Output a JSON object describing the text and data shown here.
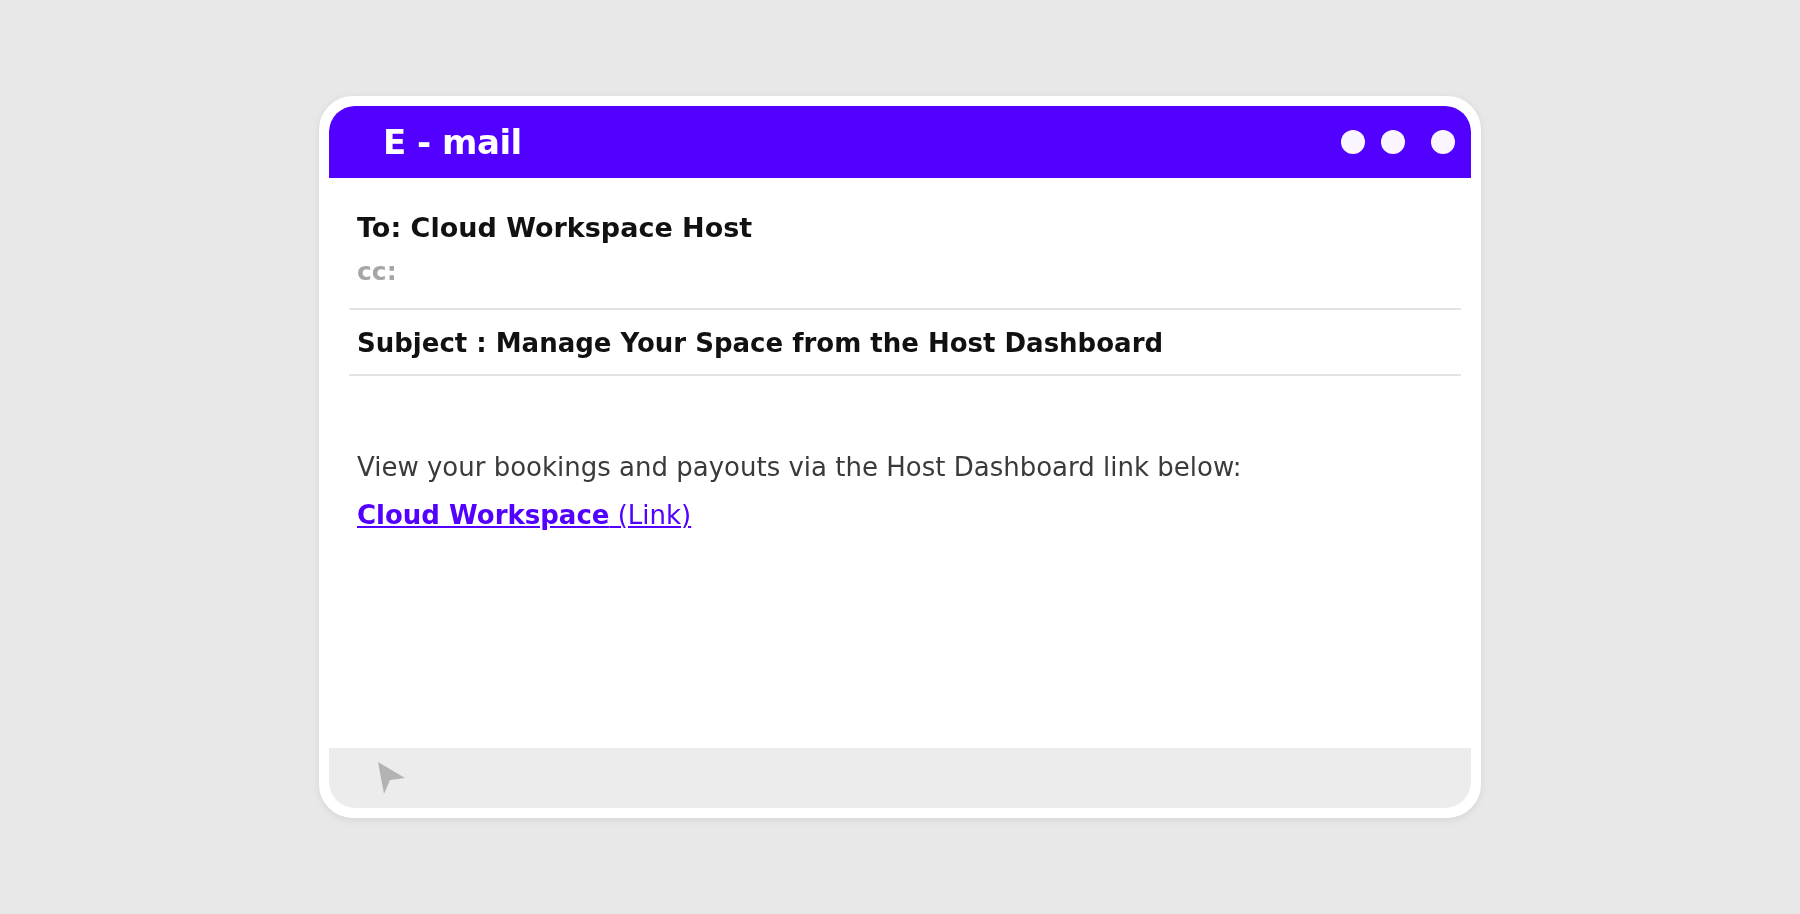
{
  "window": {
    "title": "E - mail"
  },
  "header": {
    "to": "To: Cloud Workspace Host",
    "cc": "cc:",
    "subject": "Subject : Manage Your Space from the Host Dashboard"
  },
  "body": {
    "text": "View your bookings and payouts via the Host Dashboard link below:",
    "link": "**Cloud Workspace** (Link)"
  }
}
